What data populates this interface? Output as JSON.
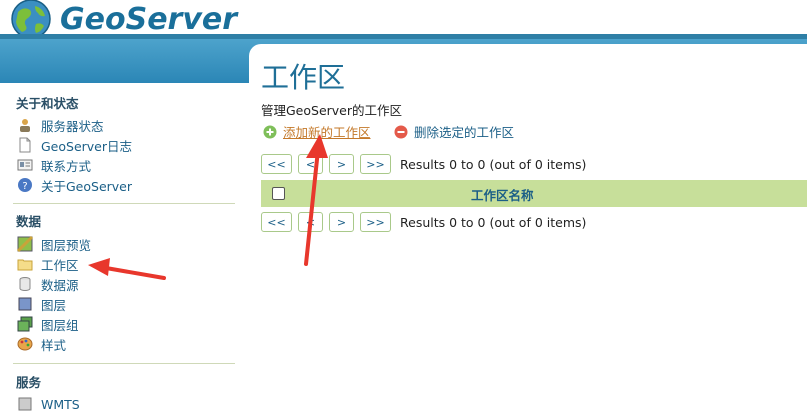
{
  "header": {
    "app_name": "GeoServer"
  },
  "sidebar": {
    "sections": [
      {
        "title": "关于和状态",
        "items": [
          {
            "label": "服务器状态",
            "icon": "server-status-icon"
          },
          {
            "label": "GeoServer日志",
            "icon": "log-file-icon"
          },
          {
            "label": "联系方式",
            "icon": "contact-card-icon"
          },
          {
            "label": "关于GeoServer",
            "icon": "about-info-icon"
          }
        ]
      },
      {
        "title": "数据",
        "items": [
          {
            "label": "图层预览",
            "icon": "layer-preview-icon"
          },
          {
            "label": "工作区",
            "icon": "folder-icon"
          },
          {
            "label": "数据源",
            "icon": "datastore-icon"
          },
          {
            "label": "图层",
            "icon": "layer-icon"
          },
          {
            "label": "图层组",
            "icon": "layer-group-icon"
          },
          {
            "label": "样式",
            "icon": "style-palette-icon"
          }
        ]
      },
      {
        "title": "服务",
        "items": [
          {
            "label": "WMTS",
            "icon": "service-icon"
          }
        ]
      }
    ]
  },
  "main": {
    "title": "工作区",
    "description": "管理GeoServer的工作区",
    "add_label": "添加新的工作区",
    "delete_label": "删除选定的工作区",
    "pager": {
      "first": "<<",
      "prev": "<",
      "next": ">",
      "last": ">>",
      "results": "Results 0 to 0 (out of 0 items)"
    },
    "table": {
      "column_name": "工作区名称"
    }
  },
  "colors": {
    "brand_blue": "#1f6f97",
    "link_orange": "#c4792a",
    "table_header_green": "#c7df9a",
    "annotation_red": "#e8372c"
  }
}
